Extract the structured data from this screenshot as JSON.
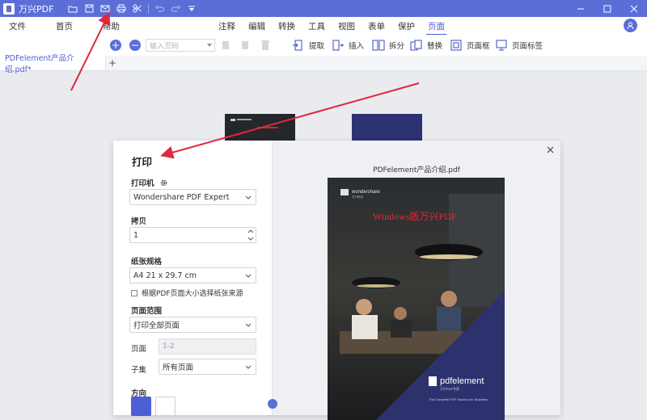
{
  "titlebar": {
    "app_name": "万兴PDF",
    "icons": [
      "folder-icon",
      "save-icon",
      "mail-icon",
      "print-icon",
      "scissors-icon",
      "undo-icon",
      "redo-icon",
      "dropdown-icon"
    ],
    "window_controls": [
      "minimize-icon",
      "maximize-icon",
      "close-icon"
    ]
  },
  "menu": {
    "left": [
      "文件",
      "首页",
      "帮助"
    ],
    "center": [
      "注释",
      "编辑",
      "转换",
      "工具",
      "视图",
      "表单",
      "保护",
      "页面"
    ],
    "active": "页面"
  },
  "toolbar": {
    "page_input_placeholder": "输入页码",
    "extract": "提取",
    "insert": "插入",
    "split": "拆分",
    "replace": "替换",
    "page_box": "页面框",
    "page_label": "页面标签"
  },
  "tab": {
    "name": "PDFelement产品介绍.pdf*",
    "add": "+"
  },
  "dialog": {
    "title": "打印",
    "printer_label": "打印机",
    "printer_value": "Wondershare PDF Expert",
    "copies_label": "拷贝",
    "copies_value": "1",
    "paper_label": "纸张规格",
    "paper_value": "A4 21 x 29.7 cm",
    "choose_source_label": "根据PDF页面大小选择纸张来源",
    "range_label": "页面范围",
    "range_value": "打印全部页面",
    "pages_label": "页面",
    "pages_value": "1-2",
    "subset_label": "子集",
    "subset_value": "所有页面",
    "orientation_label": "方向",
    "preview_title": "PDFelement产品介绍.pdf",
    "preview": {
      "brand": "wondershare",
      "brand_sub": "万兴科技",
      "watermark": "Windows版万兴PDF",
      "product": "pdfelement",
      "product_sub": "万兴PDF专家",
      "tagline": "The Complete PDF Solution for Business"
    }
  },
  "colors": {
    "accent": "#5b6ed8",
    "active_text": "#4c5fd6",
    "annotation_red": "#e0283a"
  }
}
